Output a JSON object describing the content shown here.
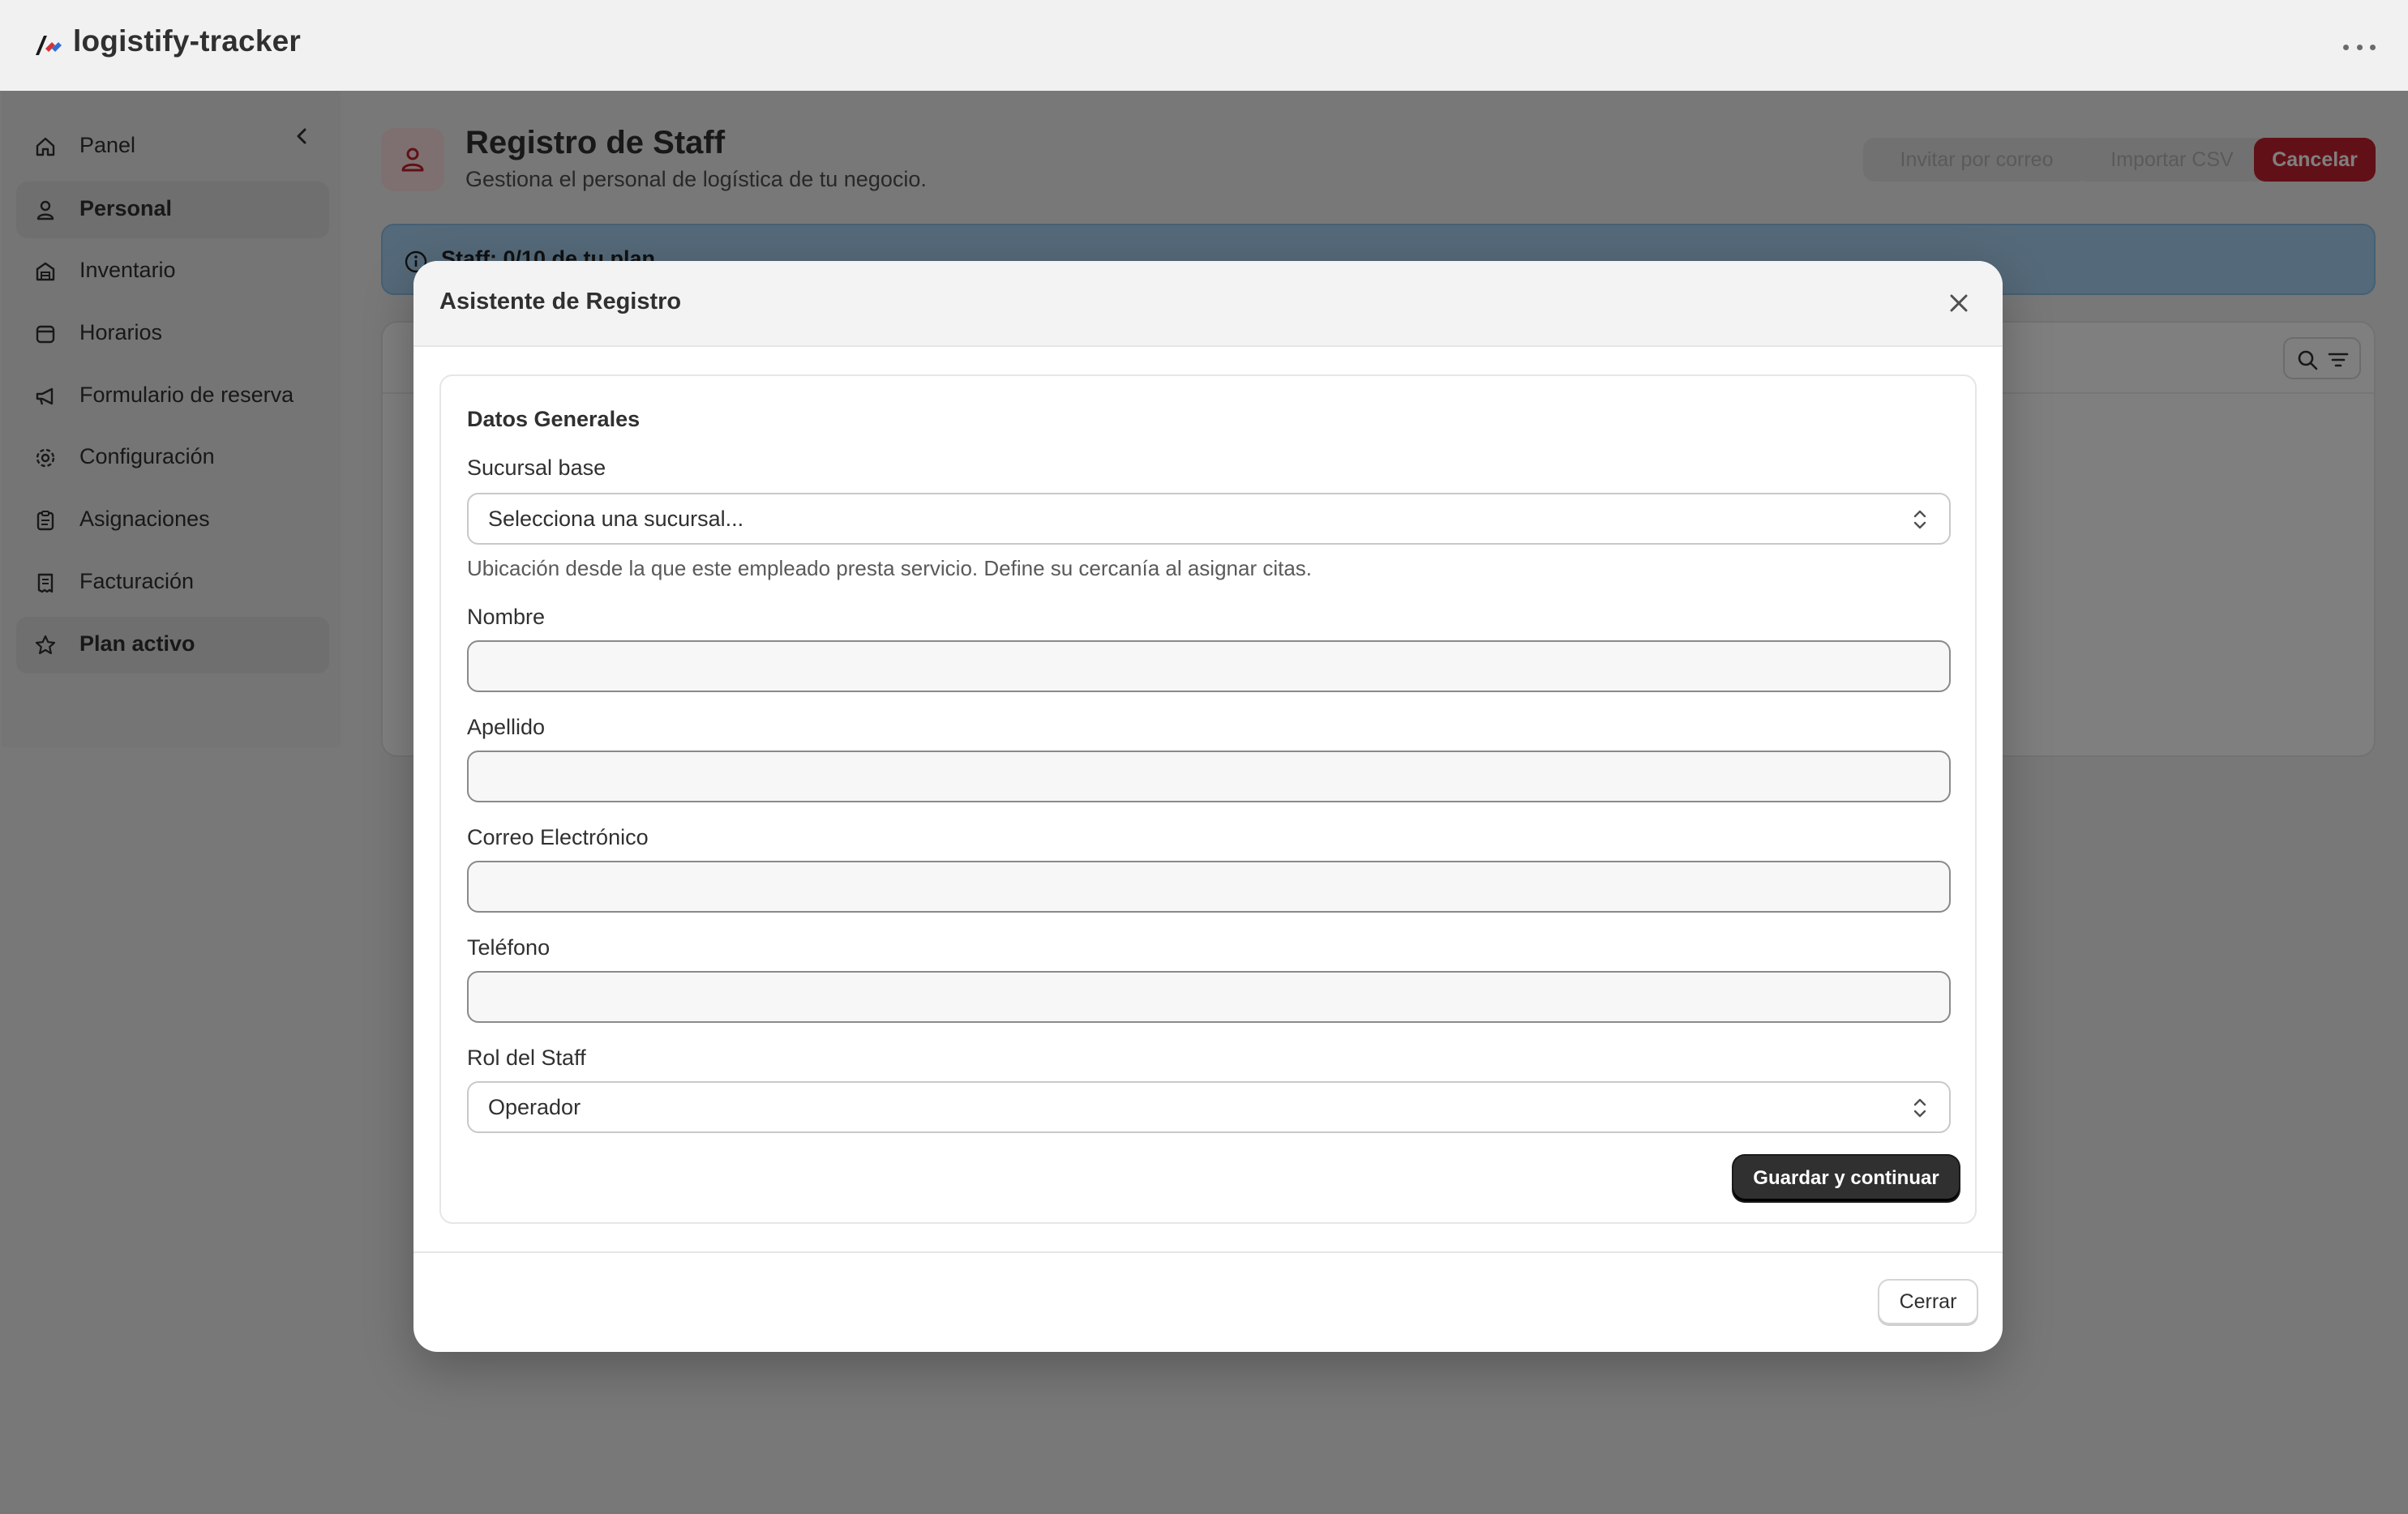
{
  "app": {
    "title": "logistify-tracker"
  },
  "sidebar": {
    "items": [
      {
        "label": "Panel",
        "icon": "home-icon",
        "active": false
      },
      {
        "label": "Personal",
        "icon": "person-icon",
        "active": true
      },
      {
        "label": "Inventario",
        "icon": "warehouse-icon",
        "active": false
      },
      {
        "label": "Horarios",
        "icon": "calendar-icon",
        "active": false
      },
      {
        "label": "Formulario de reserva",
        "icon": "megaphone-icon",
        "active": false
      },
      {
        "label": "Configuración",
        "icon": "gear-icon",
        "active": false
      },
      {
        "label": "Asignaciones",
        "icon": "clipboard-icon",
        "active": false
      },
      {
        "label": "Facturación",
        "icon": "receipt-icon",
        "active": false
      },
      {
        "label": "Plan activo",
        "icon": "star-icon",
        "active": true
      }
    ]
  },
  "header": {
    "title": "Registro de Staff",
    "subtitle": "Gestiona el personal de logística de tu negocio.",
    "invite_label": "Invitar por correo",
    "import_label": "Importar CSV",
    "cancel_label": "Cancelar"
  },
  "banner": {
    "text": "Staff: 0/10 de tu plan"
  },
  "modal": {
    "title": "Asistente de Registro",
    "section_title": "Datos Generales",
    "branch": {
      "label": "Sucursal base",
      "value": "Selecciona una sucursal...",
      "help": "Ubicación desde la que este empleado presta servicio. Define su cercanía al asignar citas."
    },
    "first_name": {
      "label": "Nombre",
      "value": ""
    },
    "last_name": {
      "label": "Apellido",
      "value": ""
    },
    "email": {
      "label": "Correo Electrónico",
      "value": ""
    },
    "phone": {
      "label": "Teléfono",
      "value": ""
    },
    "role": {
      "label": "Rol del Staff",
      "value": "Operador"
    },
    "save_label": "Guardar y continuar",
    "close_label": "Cerrar"
  },
  "colors": {
    "accent_red": "#c5202f",
    "banner_blue": "#a9d3f2",
    "primary_dark": "#303030"
  }
}
